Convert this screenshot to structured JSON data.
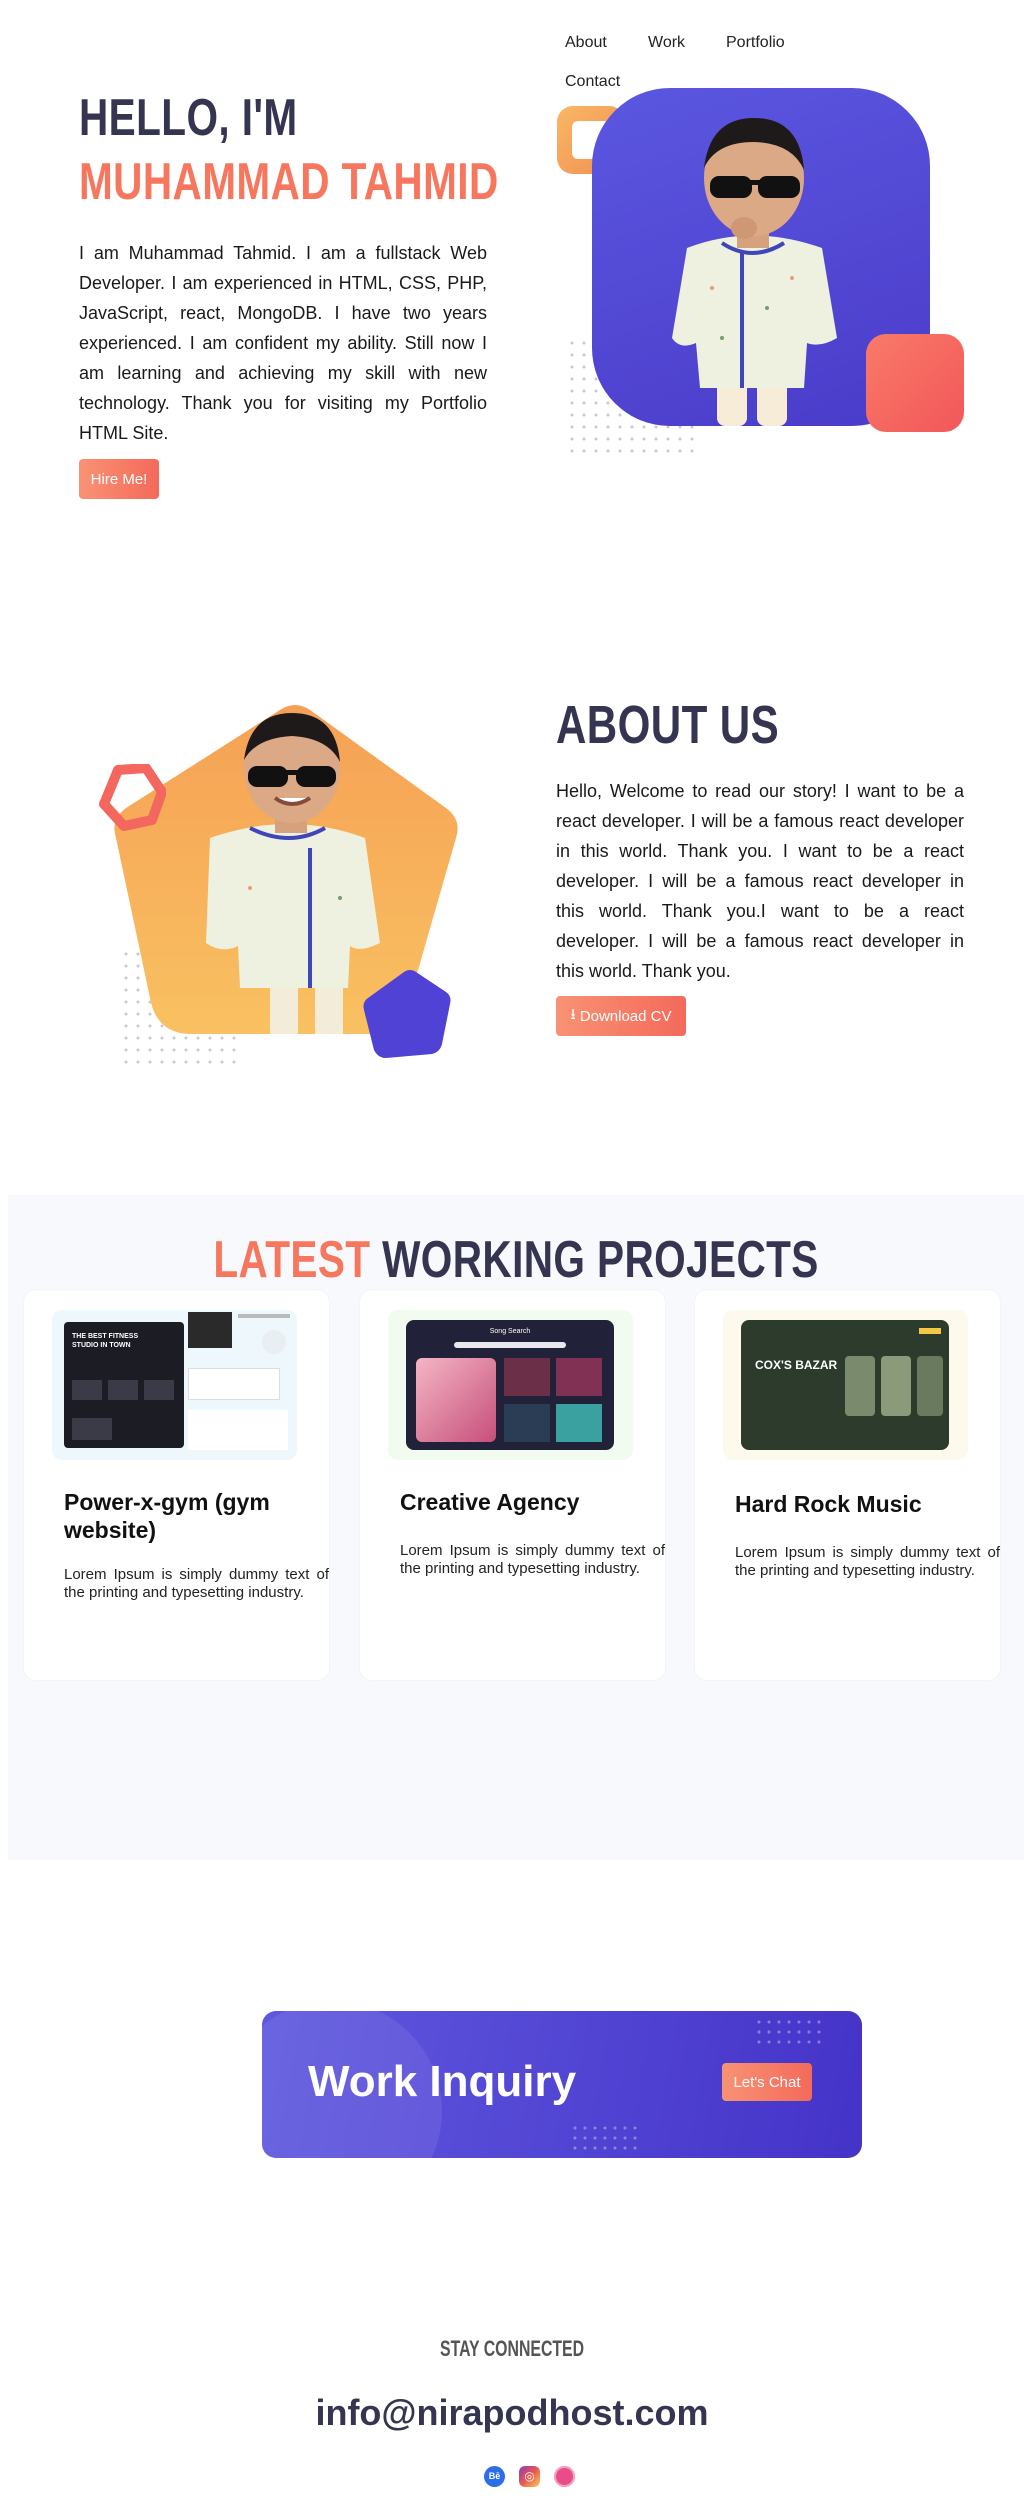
{
  "nav": {
    "items": [
      "About",
      "Work",
      "Portfolio",
      "Contact"
    ]
  },
  "hero": {
    "greeting": "HELLO, I'M",
    "name": "MUHAMMAD TAHMID",
    "bio": "I am Muhammad Tahmid. I am a fullstack Web Developer. I am experienced in HTML, CSS, PHP, JavaScript, react, MongoDB. I have two years experienced. I am confident my ability. Still now I am learning and achieving my skill with new technology. Thank you for visiting my Portfolio HTML Site.",
    "button": "Hire Me!"
  },
  "about": {
    "title": "ABOUT US",
    "text": "Hello, Welcome to read our story! I want to be a react developer. I will be a famous react developer in this world. Thank you. I want to be a react developer. I will be a famous react developer in this world. Thank you.I want to be a react developer. I will be a famous react developer in this world. Thank you.",
    "button": "Download CV",
    "button_icon": "download-icon"
  },
  "projects": {
    "title_accent": "LATEST",
    "title_rest": "WORKING PROJECTS",
    "items": [
      {
        "title": "Power-x-gym (gym website)",
        "desc_line1": "Lorem Ipsum is simply dummy text of",
        "desc_line2": "the printing and typesetting industry.",
        "thumb_caption": "THE BEST FITNESS STUDIO IN TOWN",
        "thumb_bg": "#eef8fc"
      },
      {
        "title": "Creative Agency",
        "desc_line1": "Lorem Ipsum is simply dummy text of",
        "desc_line2": "the printing and typesetting industry.",
        "thumb_caption": "Song Search",
        "thumb_bg": "#f2fbef"
      },
      {
        "title": "Hard Rock Music",
        "desc_line1": "Lorem Ipsum is simply dummy text of",
        "desc_line2": "the printing and typesetting industry.",
        "thumb_caption": "COX'S BAZAR",
        "thumb_bg": "#fdf9ec"
      }
    ]
  },
  "inquiry": {
    "title": "Work Inquiry",
    "button": "Let's Chat"
  },
  "contact": {
    "label": "STAY CONNECTED",
    "email": "info@nirapodhost.com",
    "socials": [
      {
        "name": "behance",
        "label": "Bē",
        "color": "#2d6ee8"
      },
      {
        "name": "instagram",
        "label": "◎",
        "color": "#e5407a"
      },
      {
        "name": "dribbble",
        "label": "●",
        "color": "#ea4c89"
      }
    ]
  },
  "colors": {
    "navy": "#353552",
    "coral": "#f7775e",
    "purple": "#5046d6",
    "orange": "#f6a157",
    "section_bg": "#f8f9fd"
  }
}
